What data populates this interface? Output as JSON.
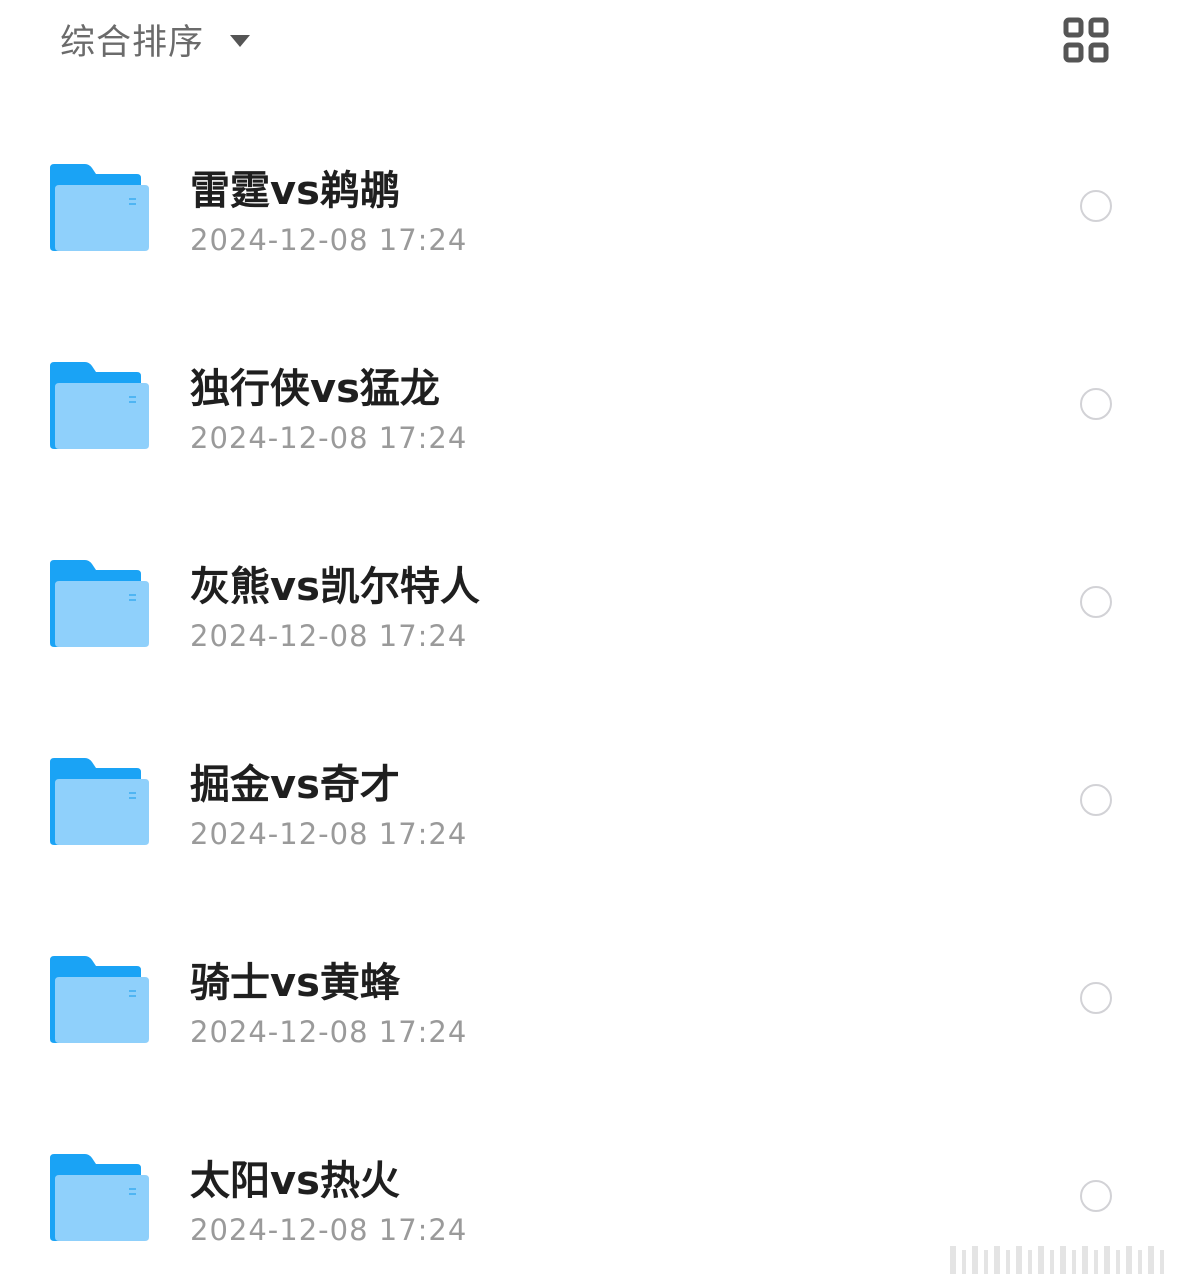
{
  "toolbar": {
    "sort_label": "综合排序",
    "sort_icon": "caret-down-icon",
    "view_toggle_icon": "grid-view-icon"
  },
  "colors": {
    "folder_back": "#1aa3f5",
    "folder_front": "#8fd0fb",
    "radio_border": "#d2d2d6",
    "title_text": "#1f1f1f",
    "date_text": "#9a9a9a"
  },
  "files": [
    {
      "name": "雷霆vs鹈鹕",
      "date": "2024-12-08 17:24",
      "icon": "folder-icon"
    },
    {
      "name": "独行侠vs猛龙",
      "date": "2024-12-08 17:24",
      "icon": "folder-icon"
    },
    {
      "name": "灰熊vs凯尔特人",
      "date": "2024-12-08 17:24",
      "icon": "folder-icon"
    },
    {
      "name": "掘金vs奇才",
      "date": "2024-12-08 17:24",
      "icon": "folder-icon"
    },
    {
      "name": "骑士vs黄蜂",
      "date": "2024-12-08 17:24",
      "icon": "folder-icon"
    },
    {
      "name": "太阳vs热火",
      "date": "2024-12-08 17:24",
      "icon": "folder-icon"
    }
  ]
}
